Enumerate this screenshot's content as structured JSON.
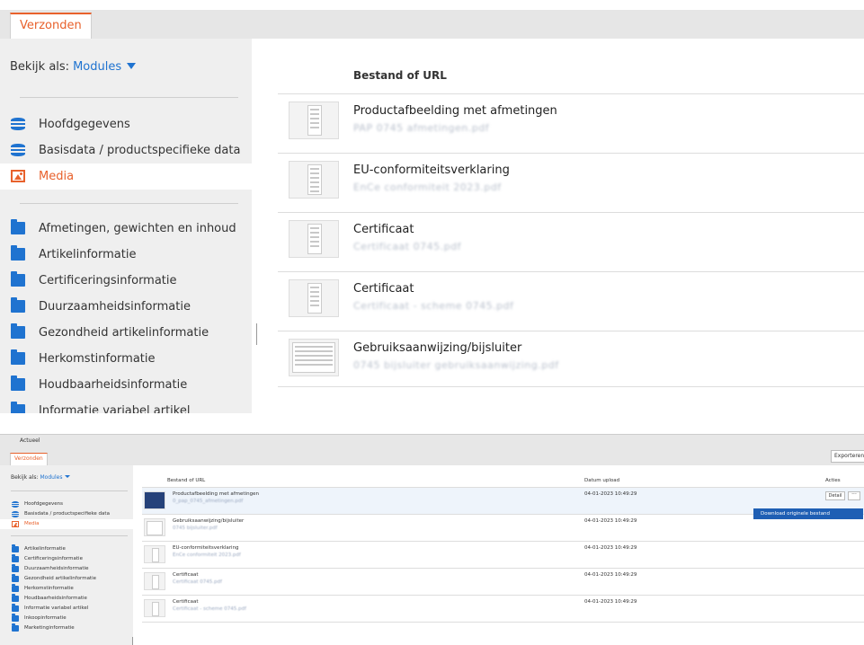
{
  "zoom": {
    "tab_label": "Verzonden",
    "view_as_label": "Bekijk als:",
    "view_as_value": "Modules",
    "nav_top": [
      {
        "label": "Hoofdgegevens",
        "icon": "database-icon"
      },
      {
        "label": "Basisdata / productspecifieke data",
        "icon": "database-icon"
      },
      {
        "label": "Media",
        "icon": "image-icon",
        "active": true
      }
    ],
    "nav_folders": [
      "Afmetingen, gewichten en inhoud",
      "Artikelinformatie",
      "Certificeringsinformatie",
      "Duurzaamheidsinformatie",
      "Gezondheid artikelinformatie",
      "Herkomstinformatie",
      "Houdbaarheidsinformatie",
      "Informatie variabel artikel"
    ],
    "column_header": "Bestand of URL",
    "files": [
      {
        "title": "Productafbeelding met afmetingen",
        "file": "PAP 0745 afmetingen.pdf"
      },
      {
        "title": "EU-conformiteitsverklaring",
        "file": "EnCe conformiteit 2023.pdf"
      },
      {
        "title": "Certificaat",
        "file": "Certificaat 0745.pdf"
      },
      {
        "title": "Certificaat",
        "file": "Certificaat - scheme 0745.pdf"
      },
      {
        "title": "Gebruiksaanwijzing/bijsluiter",
        "file": "0745 bijsluiter gebruiksaanwijzing.pdf"
      }
    ]
  },
  "app": {
    "breadcrumb": "Actueel",
    "tab_label": "Verzonden",
    "export_label": "Exporteren",
    "view_as_label": "Bekijk als:",
    "view_as_value": "Modules",
    "nav_top": [
      {
        "label": "Hoofdgegevens"
      },
      {
        "label": "Basisdata / productspecifieke data"
      },
      {
        "label": "Media",
        "active": true
      }
    ],
    "nav_folders": [
      "Artikelinformatie",
      "Certificeringsinformatie",
      "Duurzaamheidsinformatie",
      "Gezondheid artikelinformatie",
      "Herkomstinformatie",
      "Houdbaarheidsinformatie",
      "Informatie variabel artikel",
      "Inkoopinformatie",
      "Marketinginformatie"
    ],
    "columns": {
      "file": "Bestand of URL",
      "date": "Datum upload",
      "actions": "Acties"
    },
    "detail_label": "Detail",
    "more_label": "···",
    "menu_item": "Download originele bestand",
    "rows": [
      {
        "title": "Productafbeelding met afmetingen",
        "file": "0_pap_0745_afmetingen.pdf",
        "date": "04-01-2023 10:49:29"
      },
      {
        "title": "Gebruiksaanwijzing/bijsluiter",
        "file": "0745 bijsluiter.pdf",
        "date": "04-01-2023 10:49:29"
      },
      {
        "title": "EU-conformiteitsverklaring",
        "file": "EnCe conformiteit 2023.pdf",
        "date": "04-01-2023 10:49:29"
      },
      {
        "title": "Certificaat",
        "file": "Certificaat 0745.pdf",
        "date": "04-01-2023 10:49:29"
      },
      {
        "title": "Certificaat",
        "file": "Certificaat - scheme 0745.pdf",
        "date": "04-01-2023 10:49:29"
      }
    ]
  }
}
